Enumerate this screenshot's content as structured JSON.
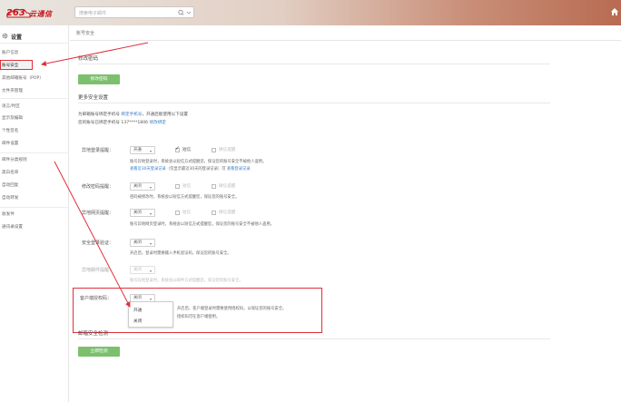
{
  "header": {
    "logo_number": "263",
    "logo_text": "云通信",
    "search_placeholder": "搜索电子邮件",
    "icons": [
      "search-icon",
      "chevron-down-icon",
      "home-icon"
    ]
  },
  "sidebar": {
    "title": "设置",
    "items": [
      {
        "label": "账户信息",
        "active": false
      },
      {
        "label": "账号安全",
        "active": true
      },
      {
        "label": "其他邮箱账号（POP）",
        "active": false
      },
      {
        "label": "文件夹管理",
        "active": false
      },
      {
        "label": "语言/时区",
        "active": false
      },
      {
        "label": "显示及编辑",
        "active": false
      },
      {
        "label": "个性签名",
        "active": false
      },
      {
        "label": "邮件设置",
        "active": false
      },
      {
        "label": "邮件分类规则",
        "active": false
      },
      {
        "label": "黑白名单",
        "active": false
      },
      {
        "label": "自动回复",
        "active": false
      },
      {
        "label": "自动转发",
        "active": false
      },
      {
        "label": "收发件",
        "active": false
      },
      {
        "label": "通讯录设置",
        "active": false
      }
    ]
  },
  "breadcrumb": "账号安全",
  "password": {
    "heading": "修改密码",
    "button": "修改密码"
  },
  "more_security": {
    "heading": "更多安全设置",
    "info_line1_a": "为邮箱账号绑定手机号 ",
    "info_line1_link": "绑定手机号",
    "info_line1_b": "，开通后能使用以下设置",
    "info_line2_a": "您的账号已绑定手机号 137****1806 ",
    "info_line2_link": "修改绑定",
    "rows": [
      {
        "label": "异地登录提醒：",
        "select": "开通",
        "check1": "短信",
        "check1_on": true,
        "check2": "微信提醒",
        "check2_on": false,
        "desc1": "账号异地登录时，系统会以短信方式提醒您，保证您的账号安全不被他人盗用。",
        "desc2_link": "查看近30天登录记录",
        "desc2_b": "（仅显示最近30天的登录记录）可 ",
        "desc2_link2": "查看登录记录"
      },
      {
        "label": "修改密码提醒：",
        "select": "关闭",
        "check1": "短信",
        "check1_on": false,
        "check2": "微信提醒",
        "check2_on": false,
        "desc1": "密码被修改时，系统会以短信方式提醒您，保证您的账号安全。"
      },
      {
        "label": "异地网页提醒：",
        "select": "关闭",
        "check1": "短信",
        "check1_on": false,
        "check2": "微信提醒",
        "check2_on": false,
        "desc1": "账号异地网页登录时，系统会以短信方式提醒您，保证您的账号安全不被他人盗用。"
      },
      {
        "label": "安全登录验证：",
        "select": "关闭",
        "desc1": "开启后，登录时需要输入手机验证码，保证您的账号安全。"
      },
      {
        "label": "异地邮件提醒：",
        "select": "关闭",
        "dim": true,
        "desc1": "账号异地登录时，系统会以邮件方式提醒您，保证您的账号安全。"
      },
      {
        "label": "客户端授权码：",
        "select": "关闭",
        "desc1": "开启后，客户端登录时需要使用授权码，以保证您的账号安全。",
        "desc2": "授权码可在客户端使用。"
      }
    ],
    "dropdown_options": [
      "开通",
      "关闭"
    ]
  },
  "checkup": {
    "heading": "邮箱安全检测",
    "button": "立即检测"
  },
  "colors": {
    "accent_green": "#7cc06e",
    "annotation_red": "#e0303a",
    "link_blue": "#3b7cc4",
    "logo_red": "#c7161e"
  }
}
